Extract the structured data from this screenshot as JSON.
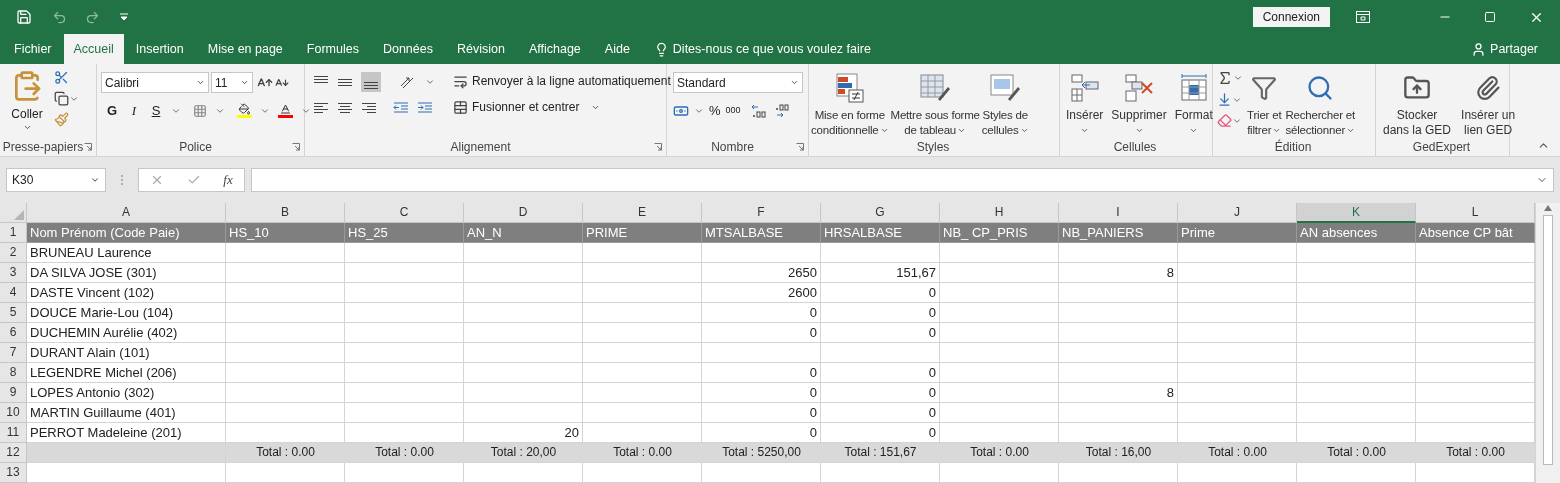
{
  "title_bar": {
    "sign_in": "Connexion"
  },
  "ribbon_tabs": [
    {
      "label": "Fichier",
      "selected": false
    },
    {
      "label": "Accueil",
      "selected": true
    },
    {
      "label": "Insertion",
      "selected": false
    },
    {
      "label": "Mise en page",
      "selected": false
    },
    {
      "label": "Formules",
      "selected": false
    },
    {
      "label": "Données",
      "selected": false
    },
    {
      "label": "Révision",
      "selected": false
    },
    {
      "label": "Affichage",
      "selected": false
    },
    {
      "label": "Aide",
      "selected": false
    }
  ],
  "tell_me": "Dites-nous ce que vous voulez faire",
  "share": "Partager",
  "clipboard": {
    "label": "Presse-papiers",
    "paste": "Coller"
  },
  "font": {
    "label": "Police",
    "font_name": "Calibri",
    "font_size": "11",
    "bold": "G",
    "italic": "I",
    "underline": "S"
  },
  "alignment": {
    "label": "Alignement",
    "wrap_text": "Renvoyer à la ligne automatiquement",
    "merge_center": "Fusionner et centrer"
  },
  "number": {
    "label": "Nombre",
    "format": "Standard",
    "percent": "%",
    "thousands": "000"
  },
  "styles": {
    "label": "Styles",
    "buttons": [
      {
        "line1": "Mise en forme",
        "line2": "conditionnelle"
      },
      {
        "line1": "Mettre sous forme",
        "line2": "de tableau"
      },
      {
        "line1": "Styles de",
        "line2": "cellules"
      }
    ]
  },
  "cells_group": {
    "label": "Cellules",
    "buttons": [
      "Insérer",
      "Supprimer",
      "Format"
    ]
  },
  "editing": {
    "label": "Édition",
    "buttons": [
      {
        "line1": "Trier et",
        "line2": "filtrer"
      },
      {
        "line1": "Rechercher et",
        "line2": "sélectionner"
      }
    ]
  },
  "gedexpert": {
    "label": "GedExpert",
    "buttons": [
      {
        "line1": "Stocker",
        "line2": "dans la GED"
      },
      {
        "line1": "Insérer un",
        "line2": "lien GED"
      }
    ]
  },
  "formula_bar": {
    "name_box": "K30",
    "function_label": "fx"
  },
  "sheet": {
    "columns": [
      {
        "letter": "A",
        "selected": false
      },
      {
        "letter": "B",
        "selected": false
      },
      {
        "letter": "C",
        "selected": false
      },
      {
        "letter": "D",
        "selected": false
      },
      {
        "letter": "E",
        "selected": false
      },
      {
        "letter": "F",
        "selected": false
      },
      {
        "letter": "G",
        "selected": false
      },
      {
        "letter": "H",
        "selected": false
      },
      {
        "letter": "I",
        "selected": false
      },
      {
        "letter": "J",
        "selected": false
      },
      {
        "letter": "K",
        "selected": true
      },
      {
        "letter": "L",
        "selected": false
      }
    ],
    "header_row": {
      "number": "1",
      "cells": [
        "Nom Prénom (Code Paie)",
        "HS_10",
        "HS_25",
        "AN_N",
        "PRIME",
        "MTSALBASE",
        "HRSALBASE",
        "NB_ CP_PRIS",
        "NB_PANIERS",
        "Prime",
        "AN absences",
        "Absence CP bât"
      ]
    },
    "rows": [
      {
        "number": "2",
        "name": "BRUNEAU Laurence",
        "values": {}
      },
      {
        "number": "3",
        "name": "DA SILVA JOSE (301)",
        "values": {
          "F": "2650",
          "G": "151,67",
          "I": "8"
        }
      },
      {
        "number": "4",
        "name": "DASTE Vincent (102)",
        "values": {
          "F": "2600",
          "G": "0"
        }
      },
      {
        "number": "5",
        "name": "DOUCE Marie-Lou (104)",
        "values": {
          "F": "0",
          "G": "0"
        }
      },
      {
        "number": "6",
        "name": "DUCHEMIN Aurélie (402)",
        "values": {
          "F": "0",
          "G": "0"
        }
      },
      {
        "number": "7",
        "name": "DURANT Alain (101)",
        "values": {}
      },
      {
        "number": "8",
        "name": "LEGENDRE Michel (206)",
        "values": {
          "F": "0",
          "G": "0"
        }
      },
      {
        "number": "9",
        "name": "LOPES Antonio (302)",
        "values": {
          "F": "0",
          "G": "0",
          "I": "8"
        }
      },
      {
        "number": "10",
        "name": "MARTIN Guillaume (401)",
        "values": {
          "F": "0",
          "G": "0"
        }
      },
      {
        "number": "11",
        "name": "PERROT Madeleine (201)",
        "values": {
          "D": "20",
          "F": "0",
          "G": "0"
        }
      }
    ],
    "totals_row": {
      "number": "12",
      "totals": [
        "Total : 0.00",
        "Total : 0.00",
        "Total : 20,00",
        "Total : 0.00",
        "Total : 5250,00",
        "Total : 151,67",
        "Total : 0.00",
        "Total : 16,00",
        "Total : 0.00",
        "Total : 0.00",
        "Total : 0.00"
      ]
    },
    "empty_row": {
      "number": "13"
    }
  }
}
